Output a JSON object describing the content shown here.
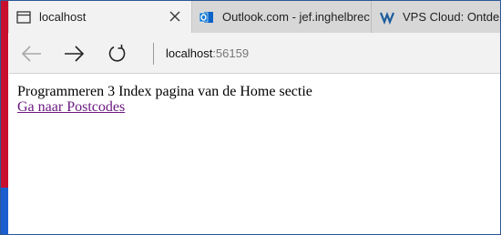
{
  "tabs": [
    {
      "title": "localhost",
      "icon": "page-icon",
      "active": true
    },
    {
      "title": "Outlook.com - jef.inghelbrec",
      "icon": "outlook-icon",
      "active": false
    },
    {
      "title": "VPS Cloud: Ontdek",
      "icon": "vps-icon",
      "active": false
    }
  ],
  "nav": {
    "back_icon": "arrow-left-icon",
    "forward_icon": "arrow-right-icon",
    "refresh_icon": "refresh-icon"
  },
  "address": {
    "host": "localhost",
    "port": ":56159"
  },
  "page": {
    "heading": "Programmeren 3 Index pagina van de Home sectie",
    "link": "Ga naar Postcodes"
  },
  "colors": {
    "accent_red": "#c8102e",
    "accent_blue": "#1b5fcf",
    "visited_link": "#6b1a80",
    "outlook_blue": "#0a64c8"
  }
}
